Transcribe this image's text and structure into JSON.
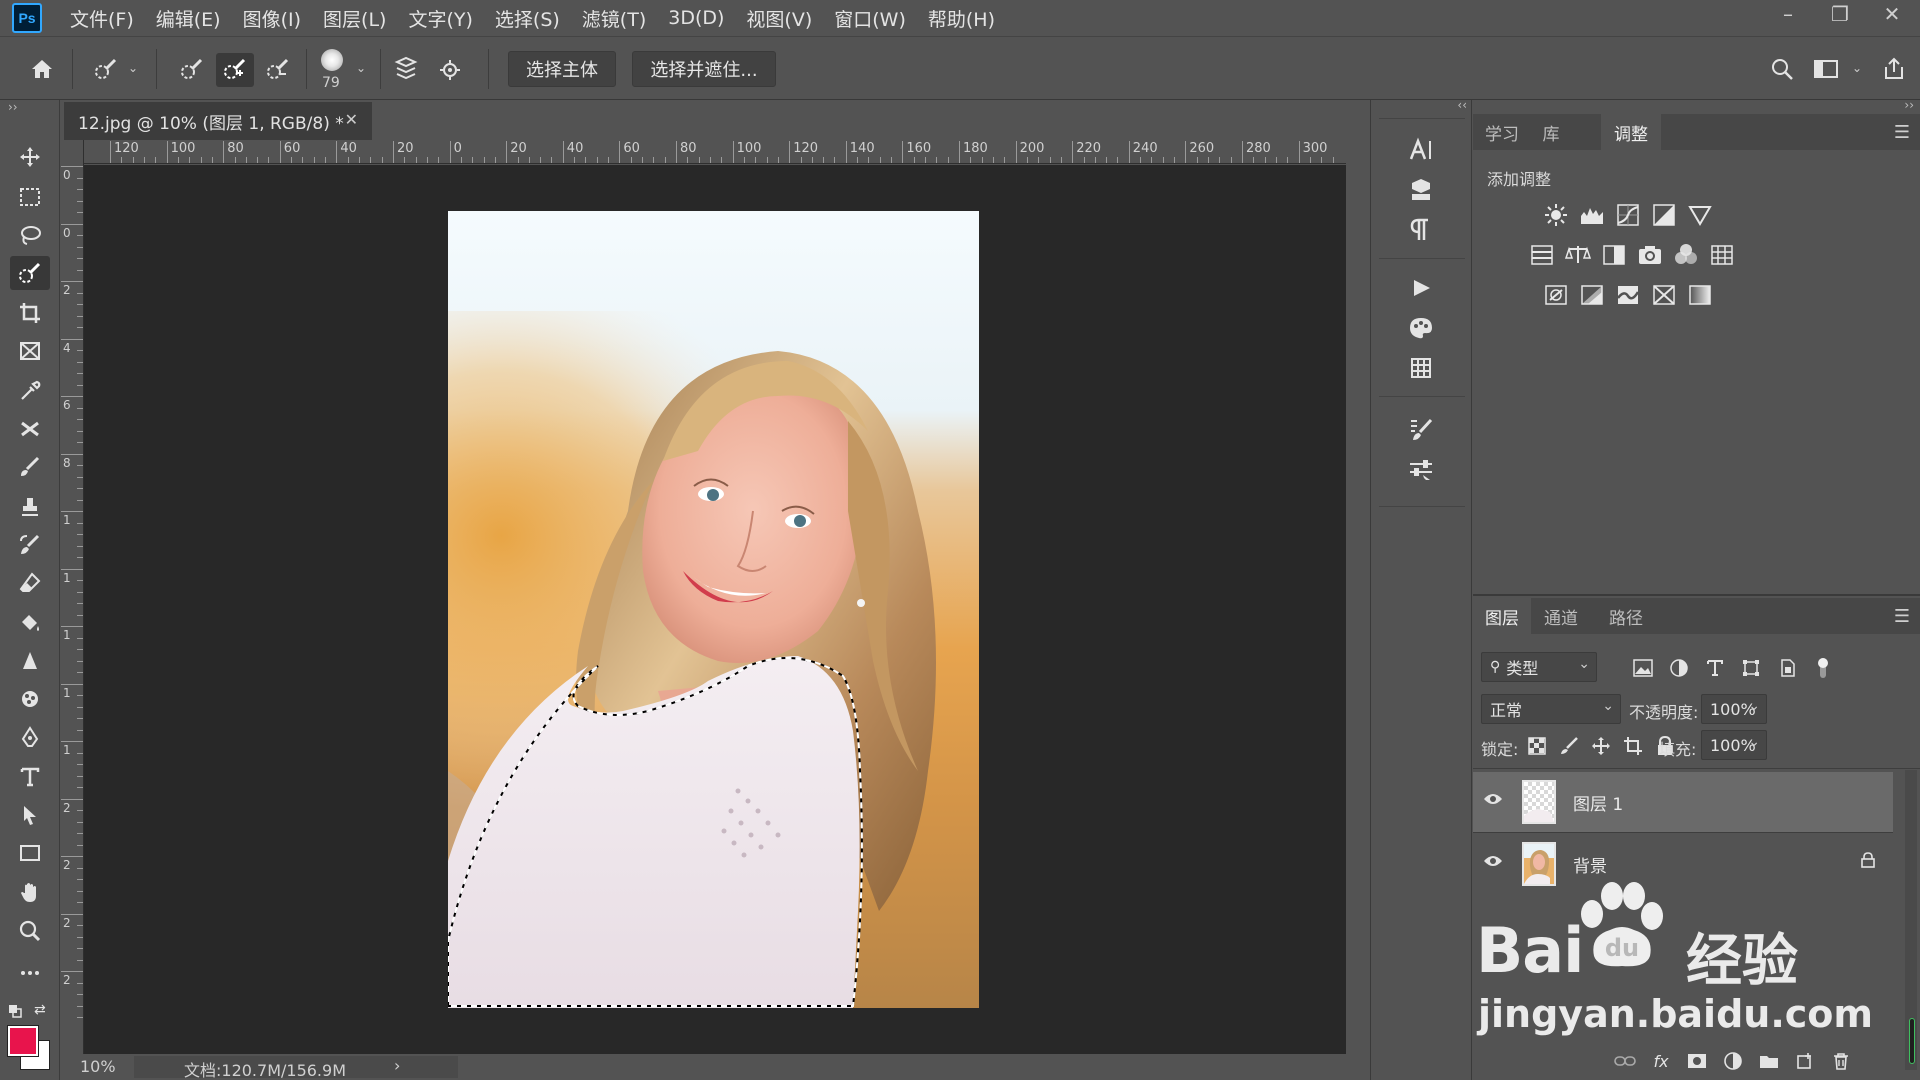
{
  "menubar": {
    "logo": "Ps",
    "items": [
      "文件(F)",
      "编辑(E)",
      "图像(I)",
      "图层(L)",
      "文字(Y)",
      "选择(S)",
      "滤镜(T)",
      "3D(D)",
      "视图(V)",
      "窗口(W)",
      "帮助(H)"
    ]
  },
  "options": {
    "brush_size": "79",
    "select_subject": "选择主体",
    "select_and_mask": "选择并遮住..."
  },
  "document": {
    "tab_title": "12.jpg @ 10% (图层 1, RGB/8) *",
    "zoom": "10%",
    "doc_info": "文档:120.7M/156.9M",
    "ruler_h_labels": [
      "120",
      "100",
      "80",
      "60",
      "40",
      "20",
      "0",
      "20",
      "40",
      "60",
      "80",
      "100",
      "120",
      "140",
      "160",
      "180",
      "200",
      "220",
      "240",
      "260",
      "280",
      "300"
    ],
    "ruler_v_labels": [
      "0",
      "0",
      "2",
      "4",
      "6",
      "8",
      "1",
      "1",
      "1",
      "1",
      "1",
      "2",
      "2",
      "2",
      "2"
    ]
  },
  "adjust_panel": {
    "tabs": [
      "学习",
      "库",
      "调整"
    ],
    "active_tab": "调整",
    "heading": "添加调整"
  },
  "layers_panel": {
    "tabs": [
      "图层",
      "通道",
      "路径"
    ],
    "filter_label": "类型",
    "blend_mode": "正常",
    "opacity_label": "不透明度:",
    "opacity": "100%",
    "lock_label": "锁定:",
    "fill_label": "填充:",
    "fill": "100%",
    "layers": [
      {
        "name": "图层 1",
        "selected": true,
        "locked": false
      },
      {
        "name": "背景",
        "selected": false,
        "locked": true
      }
    ]
  },
  "watermark": {
    "brand_a": "Bai",
    "brand_b": "du",
    "brand_c": "经验",
    "url": "jingyan.baidu.com"
  },
  "colors": {
    "accent": "#31a8ff",
    "foreground_color": "#e8144c",
    "background_color": "#ffffff"
  }
}
